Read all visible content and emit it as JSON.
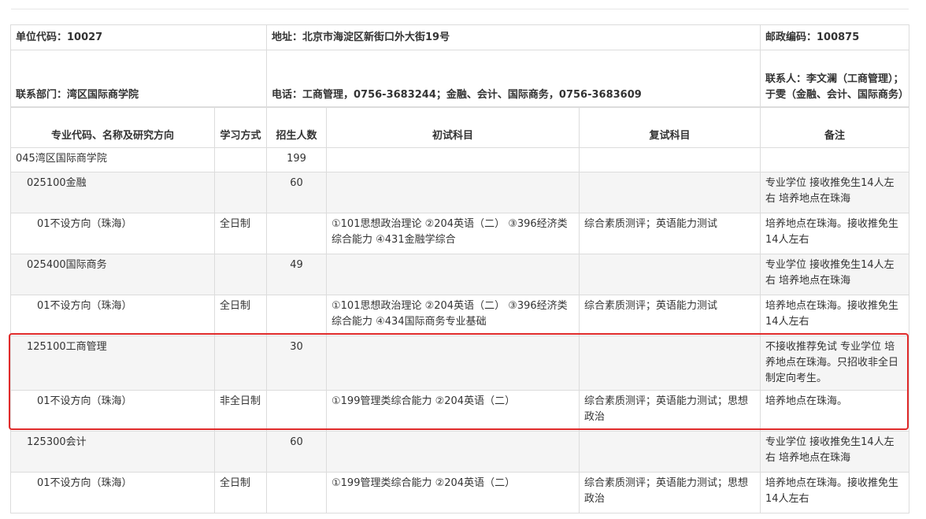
{
  "info": {
    "unit_code": "单位代码：10027",
    "address": "地址：北京市海淀区新街口外大街19号",
    "postcode": "邮政编码：100875",
    "department": "联系部门：湾区国际商学院",
    "phone": "电话：工商管理，0756-3683244；金融、会计、国际商务，0756-3683609",
    "contact": "联系人：李文澜（工商管理）；于雯（金融、会计、国际商务）"
  },
  "headers": {
    "major": "专业代码、名称及研究方向",
    "mode": "学习方式",
    "quota": "招生人数",
    "exam": "初试科目",
    "retest": "复试科目",
    "note": "备注"
  },
  "rows": [
    {
      "major": "045湾区国际商学院",
      "mode": "",
      "quota": "199",
      "exam": "",
      "retest": "",
      "note": ""
    },
    {
      "major": "025100金融",
      "mode": "",
      "quota": "60",
      "exam": "",
      "retest": "",
      "note": "专业学位 接收推免生14人左右 培养地点在珠海"
    },
    {
      "major": "01不设方向（珠海）",
      "mode": "全日制",
      "quota": "",
      "exam": "①101思想政治理论 ②204英语（二） ③396经济类综合能力 ④431金融学综合",
      "retest": "综合素质测评；英语能力测试",
      "note": "培养地点在珠海。接收推免生14人左右"
    },
    {
      "major": "025400国际商务",
      "mode": "",
      "quota": "49",
      "exam": "",
      "retest": "",
      "note": "专业学位 接收推免生14人左右 培养地点在珠海"
    },
    {
      "major": "01不设方向（珠海）",
      "mode": "全日制",
      "quota": "",
      "exam": "①101思想政治理论 ②204英语（二） ③396经济类综合能力 ④434国际商务专业基础",
      "retest": "综合素质测评；英语能力测试",
      "note": "培养地点在珠海。接收推免生14人左右"
    },
    {
      "major": "125100工商管理",
      "mode": "",
      "quota": "30",
      "exam": "",
      "retest": "",
      "note": "不接收推荐免试 专业学位 培养地点在珠海。只招收非全日制定向考生。"
    },
    {
      "major": "01不设方向（珠海）",
      "mode": "非全日制",
      "quota": "",
      "exam": "①199管理类综合能力 ②204英语（二）",
      "retest": "综合素质测评；英语能力测试；思想政治",
      "note": "培养地点在珠海。"
    },
    {
      "major": "125300会计",
      "mode": "",
      "quota": "60",
      "exam": "",
      "retest": "",
      "note": "专业学位 接收推免生14人左右 培养地点在珠海"
    },
    {
      "major": "01不设方向（珠海）",
      "mode": "全日制",
      "quota": "",
      "exam": "①199管理类综合能力 ②204英语（二）",
      "retest": "综合素质测评；英语能力测试；思想政治",
      "note": "培养地点在珠海。接收推免生14人左右"
    }
  ],
  "colors": {
    "border": "#dcdcdc",
    "highlight": "#e02b2b",
    "row_alt": "#f5f5f5"
  }
}
